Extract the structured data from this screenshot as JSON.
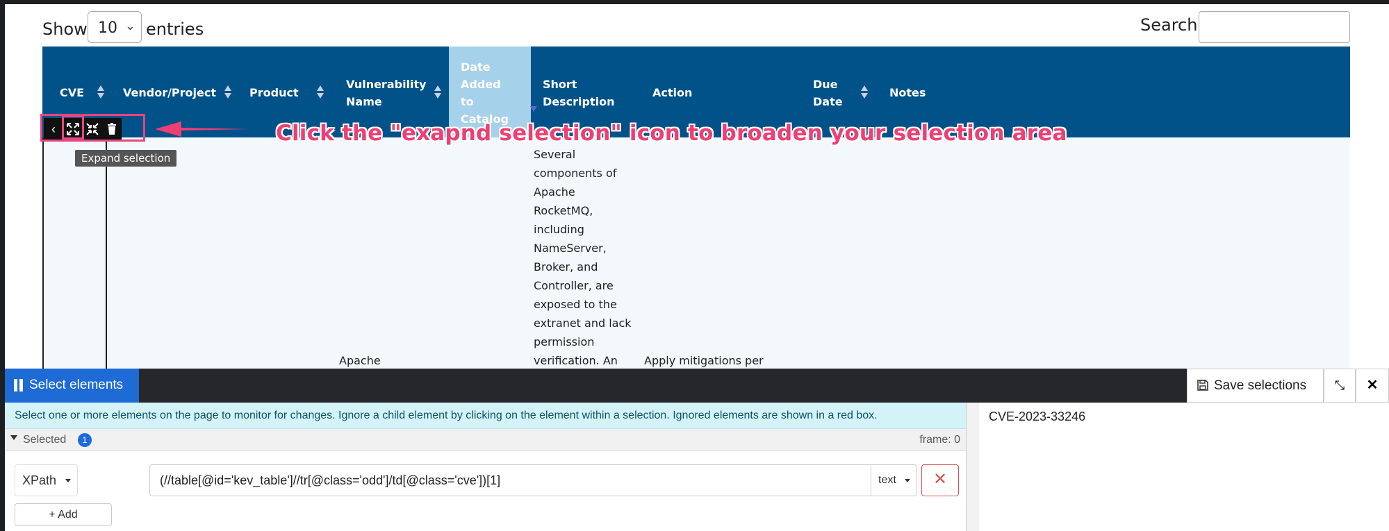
{
  "table_controls": {
    "show_label": "Show",
    "page_length": "10",
    "entries_label": "entries",
    "search_label": "Search:",
    "search_value": ""
  },
  "table": {
    "header_color": "#005289",
    "sorted_column_color": "#a6d1ea",
    "columns": [
      {
        "label": "CVE"
      },
      {
        "label": "Vendor/Project"
      },
      {
        "label": "Product"
      },
      {
        "label": "Vulnerability\nName"
      },
      {
        "label": "Date\nAdded\nto\nCatalog"
      },
      {
        "label": "Short\nDescription"
      },
      {
        "label": "Action"
      },
      {
        "label": "Due\nDate"
      },
      {
        "label": "Notes"
      }
    ],
    "row": {
      "vulnerability_name": "Apache",
      "short_description": "Several\ncomponents of\nApache\nRocketMQ,\nincluding\nNameServer,\nBroker, and\nController, are\nexposed to the\nextranet and lack\npermission\nverification. An",
      "action": "Apply mitigations per"
    }
  },
  "overlay": {
    "tooltip": "Expand selection",
    "callout": "Click the \"exapnd selection\" icon to broaden your selection area",
    "highlight_color": "#e8457e"
  },
  "panel": {
    "tab_label": "Select elements",
    "save_label": "Save selections",
    "info": "Select one or more elements on the page to monitor for changes. Ignore a child element by clicking on the element within a selection. Ignored elements are shown in a red box.",
    "selected_label": "Selected",
    "selected_count": "1",
    "frame_label": "frame: 0",
    "selector_type": "XPath",
    "xpath": "(//table[@id='kev_table']//tr[@class='odd']/td[@class='cve'])[1]",
    "output_type": "text",
    "add_label": "+ Add",
    "result": "CVE-2023-33246",
    "accent_color": "#1e6bd6"
  }
}
